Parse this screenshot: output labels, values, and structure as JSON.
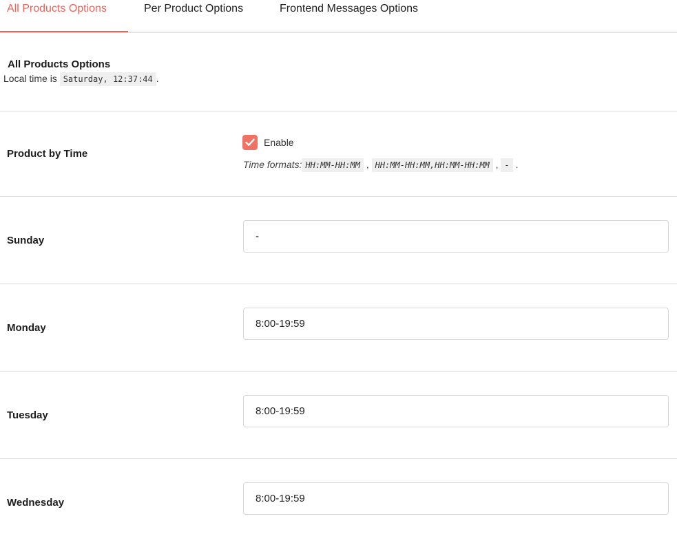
{
  "tabs": [
    {
      "label": "All Products Options",
      "active": true
    },
    {
      "label": "Per Product Options",
      "active": false
    },
    {
      "label": "Frontend Messages Options",
      "active": false
    }
  ],
  "section": {
    "title": "All Products Options",
    "local_time_prefix": "Local time is",
    "local_time_value": "Saturday, 12:37:44",
    "local_time_suffix": "."
  },
  "product_by_time": {
    "label": "Product by Time",
    "checkbox_label": "Enable",
    "checked": true,
    "help_prefix": "Time formats:",
    "formats": [
      "HH:MM-HH:MM",
      "HH:MM-HH:MM,HH:MM-HH:MM",
      "-"
    ],
    "sep1": ",",
    "sep2": ",",
    "help_suffix": "."
  },
  "days": [
    {
      "label": "Sunday",
      "value": "-"
    },
    {
      "label": "Monday",
      "value": "8:00-19:59"
    },
    {
      "label": "Tuesday",
      "value": "8:00-19:59"
    },
    {
      "label": "Wednesday",
      "value": "8:00-19:59"
    }
  ],
  "colors": {
    "accent": "#e8665a",
    "checkbox": "#f07264"
  }
}
